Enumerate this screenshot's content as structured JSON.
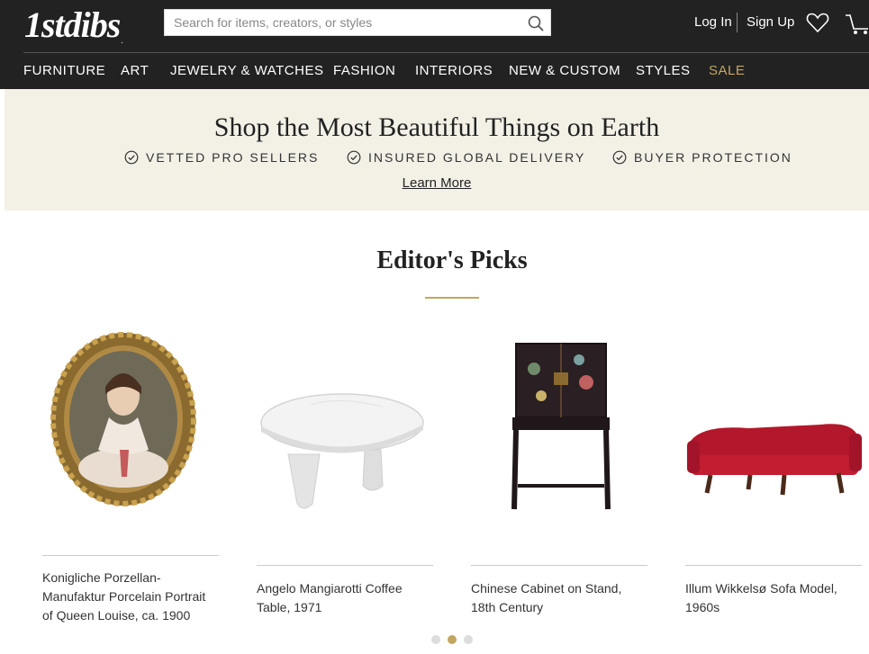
{
  "header": {
    "logo": "1stdibs",
    "logo_mark": ".",
    "search_placeholder": "Search for items, creators, or styles",
    "login": "Log In",
    "signup": "Sign Up",
    "icons": {
      "search": "search-icon",
      "favorites": "heart-icon",
      "cart": "cart-icon"
    }
  },
  "nav": {
    "items": [
      "FURNITURE",
      "ART",
      "JEWELRY & WATCHES",
      "FASHION",
      "INTERIORS",
      "NEW & CUSTOM",
      "STYLES",
      "SALE"
    ]
  },
  "banner": {
    "title": "Shop the Most Beautiful Things on Earth",
    "features": [
      "VETTED PRO SELLERS",
      "INSURED GLOBAL DELIVERY",
      "BUYER PROTECTION"
    ],
    "learn_more": "Learn More"
  },
  "picks": {
    "title": "Editor's Picks",
    "products": [
      {
        "name": "Konigliche Porzellan-Manufaktur Porcelain Portrait of Queen Louise, ca. 1900",
        "image": "oval-portrait-gilt-frame"
      },
      {
        "name": "Angelo Mangiarotti Coffee Table, 1971",
        "image": "white-marble-table"
      },
      {
        "name": "Chinese Cabinet on Stand, 18th Century",
        "image": "lacquer-cabinet-on-stand"
      },
      {
        "name": "Illum Wikkelsø Sofa Model, 1960s",
        "image": "red-sofa"
      }
    ],
    "carousel": {
      "pages": 3,
      "active_page": 2
    }
  },
  "colors": {
    "header_bg": "#222222",
    "accent_gold": "#c2a661",
    "banner_bg": "#f3f0e6"
  }
}
